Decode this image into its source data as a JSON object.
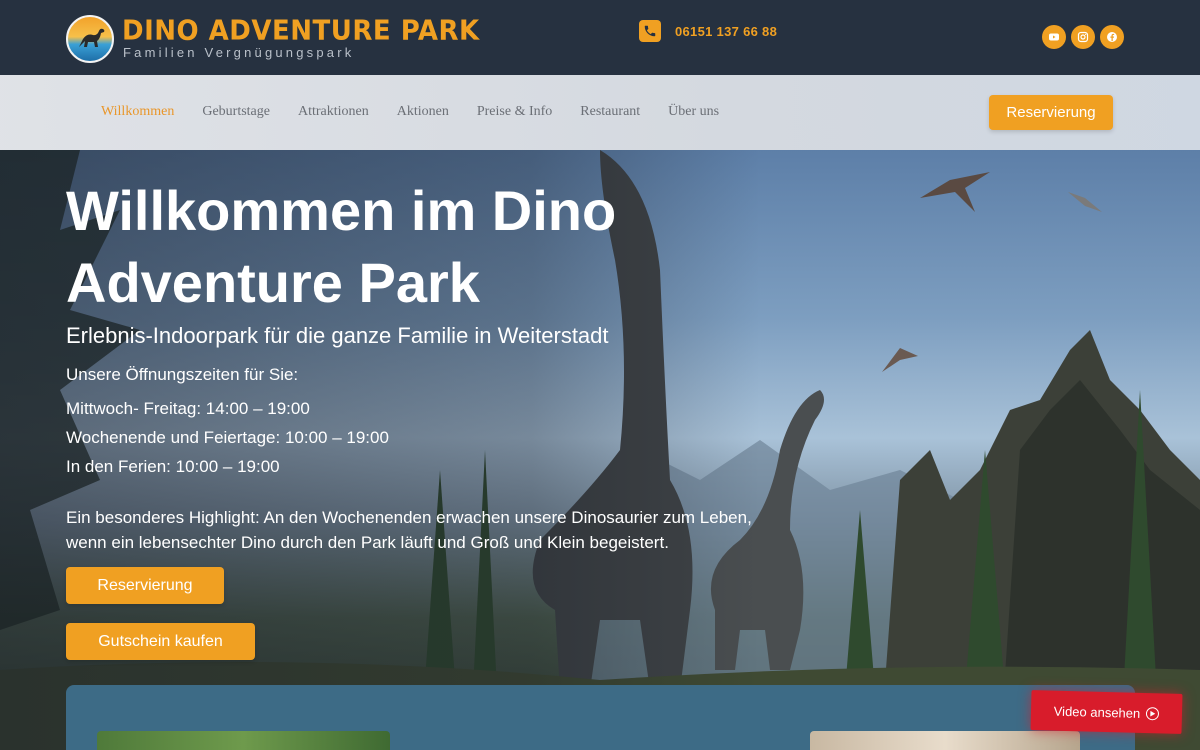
{
  "brand": {
    "title": "DINO ADVENTURE PARK",
    "subtitle": "Familien Vergnügungspark",
    "colors": {
      "accent": "#f0a022",
      "topbar": "#263140",
      "panel": "#3d6b86",
      "video": "#d81c2b"
    }
  },
  "contact": {
    "phone": "06151 137 66 88",
    "icon": "phone-icon"
  },
  "socials": [
    {
      "name": "youtube",
      "icon": "youtube-icon"
    },
    {
      "name": "instagram",
      "icon": "instagram-icon"
    },
    {
      "name": "facebook",
      "icon": "facebook-icon"
    }
  ],
  "nav": {
    "items": [
      {
        "label": "Willkommen",
        "active": true
      },
      {
        "label": "Geburtstage"
      },
      {
        "label": "Attraktionen"
      },
      {
        "label": "Aktionen"
      },
      {
        "label": "Preise & Info"
      },
      {
        "label": "Restaurant"
      },
      {
        "label": "Über uns"
      }
    ],
    "reserve_label": "Reservierung"
  },
  "hero": {
    "title": "Willkommen im Dino Adventure Park",
    "subtitle": "Erlebnis-Indoorpark für die ganze Familie in Weiterstadt",
    "hours_heading": "Unsere Öffnungszeiten für Sie:",
    "hours": [
      "Mittwoch- Freitag: 14:00 – 19:00",
      "Wochenende und Feiertage: 10:00 – 19:00",
      "In den Ferien: 10:00 – 19:00"
    ],
    "highlight": "Ein besonderes Highlight: An den Wochenenden erwachen unsere Dinosaurier zum Leben, wenn ein lebensechter Dino durch den Park läuft und Groß und Klein begeistert.",
    "reserve_label": "Reservierung",
    "voucher_label": "Gutschein kaufen"
  },
  "video": {
    "label": "Video ansehen",
    "icon": "play-circle-icon"
  }
}
